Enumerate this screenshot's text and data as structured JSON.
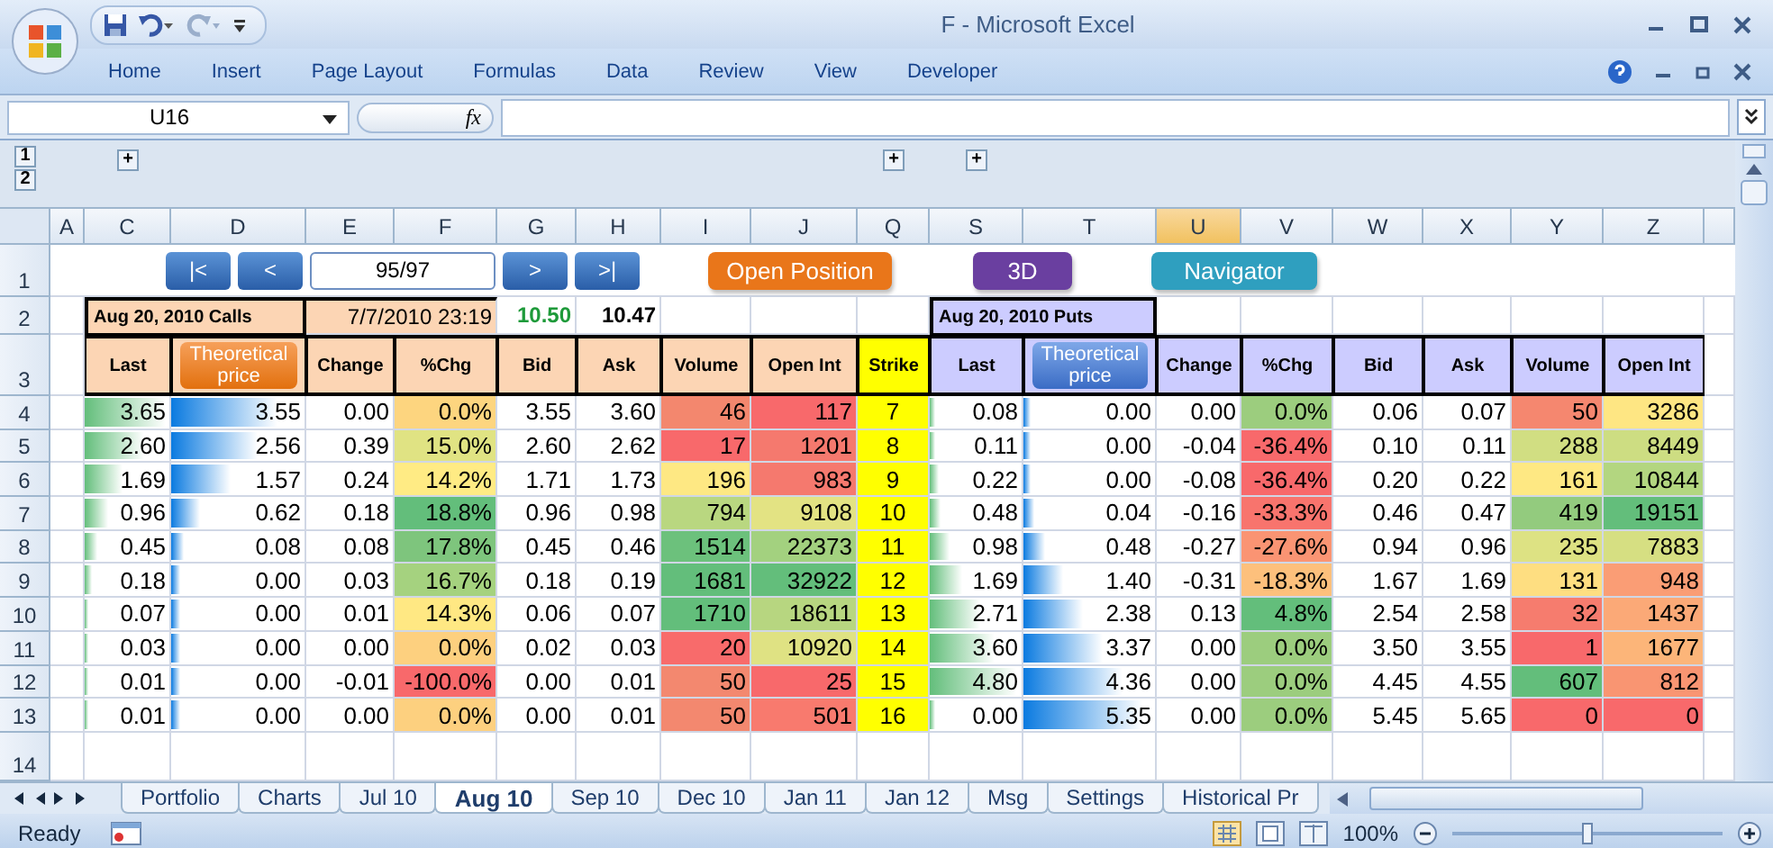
{
  "window": {
    "title": "F - Microsoft Excel"
  },
  "ribbon_tabs": [
    "Home",
    "Insert",
    "Page Layout",
    "Formulas",
    "Data",
    "Review",
    "View",
    "Developer"
  ],
  "formula_bar": {
    "name_box": "U16",
    "function_label": "fx"
  },
  "outline": {
    "levels": [
      "1",
      "2"
    ],
    "expand_buttons": [
      "+",
      "+",
      "+"
    ]
  },
  "column_headers": [
    {
      "label": "A",
      "selected": false
    },
    {
      "label": "C",
      "selected": false
    },
    {
      "label": "D",
      "selected": false
    },
    {
      "label": "E",
      "selected": false
    },
    {
      "label": "F",
      "selected": false
    },
    {
      "label": "G",
      "selected": false
    },
    {
      "label": "H",
      "selected": false
    },
    {
      "label": "I",
      "selected": false
    },
    {
      "label": "J",
      "selected": false
    },
    {
      "label": "Q",
      "selected": false
    },
    {
      "label": "S",
      "selected": false
    },
    {
      "label": "T",
      "selected": false
    },
    {
      "label": "U",
      "selected": true
    },
    {
      "label": "V",
      "selected": false
    },
    {
      "label": "W",
      "selected": false
    },
    {
      "label": "X",
      "selected": false
    },
    {
      "label": "Y",
      "selected": false
    },
    {
      "label": "Z",
      "selected": false
    }
  ],
  "row_numbers": [
    "1",
    "2",
    "3",
    "4",
    "5",
    "6",
    "7",
    "8",
    "9",
    "10",
    "11",
    "12",
    "13",
    "14"
  ],
  "navigation": {
    "back_buttons": [
      "|<",
      "<"
    ],
    "position": "95/97",
    "forward_buttons": [
      ">",
      ">|"
    ]
  },
  "action_buttons": [
    {
      "label": "Open Position",
      "color": "#e9761a"
    },
    {
      "label": "3D",
      "color": "#6a3fa0"
    },
    {
      "label": "Navigator",
      "color": "#2f9fbf"
    }
  ],
  "calls": {
    "title": "Aug 20, 2010 Calls",
    "timestamp": "7/7/2010 23:19",
    "price": "10.50",
    "price_2": "10.47"
  },
  "puts": {
    "title": "Aug 20, 2010 Puts"
  },
  "calls_columns": [
    {
      "label": "Last",
      "kind": "header"
    },
    {
      "label": "Theoretical price",
      "kind": "button"
    },
    {
      "label": "Change",
      "kind": "header"
    },
    {
      "label": "%Chg",
      "kind": "header"
    },
    {
      "label": "Bid",
      "kind": "header"
    },
    {
      "label": "Ask",
      "kind": "header"
    },
    {
      "label": "Volume",
      "kind": "header"
    },
    {
      "label": "Open Int",
      "kind": "header"
    }
  ],
  "strike_column": "Strike",
  "puts_columns": [
    {
      "label": "Last",
      "kind": "header"
    },
    {
      "label": "Theoretical price",
      "kind": "button"
    },
    {
      "label": "Change",
      "kind": "header"
    },
    {
      "label": "%Chg",
      "kind": "header"
    },
    {
      "label": "Bid",
      "kind": "header"
    },
    {
      "label": "Ask",
      "kind": "header"
    },
    {
      "label": "Volume",
      "kind": "header"
    },
    {
      "label": "Open Int",
      "kind": "header"
    }
  ],
  "rows": [
    {
      "calls": [
        {
          "text": "3.65",
          "level": 0.95
        },
        {
          "text": "3.55",
          "level": 0.8
        },
        {
          "text": "0.00"
        },
        {
          "text": "0.0%",
          "color": "#fdd57f"
        },
        {
          "text": "3.55"
        },
        {
          "text": "3.60"
        },
        {
          "text": "46",
          "color": "#f3876e"
        },
        {
          "text": "117",
          "color": "#f8696b"
        }
      ],
      "strike": "7",
      "puts": [
        {
          "text": "0.08",
          "level": 0.05
        },
        {
          "text": "0.00",
          "level": 0.06
        },
        {
          "text": "0.00"
        },
        {
          "text": "0.0%",
          "color": "#9ccd7e"
        },
        {
          "text": "0.06"
        },
        {
          "text": "0.07"
        },
        {
          "text": "50",
          "color": "#f5876f"
        },
        {
          "text": "3286",
          "color": "#fee683"
        }
      ]
    },
    {
      "calls": [
        {
          "text": "2.60",
          "level": 0.7
        },
        {
          "text": "2.56",
          "level": 0.65
        },
        {
          "text": "0.39"
        },
        {
          "text": "15.0%",
          "color": "#e0e383"
        },
        {
          "text": "2.60"
        },
        {
          "text": "2.62"
        },
        {
          "text": "17",
          "color": "#f8696b"
        },
        {
          "text": "1201",
          "color": "#f5796e"
        }
      ],
      "strike": "8",
      "puts": [
        {
          "text": "0.11",
          "level": 0.06
        },
        {
          "text": "0.00",
          "level": 0.06
        },
        {
          "text": "-0.04"
        },
        {
          "text": "-36.4%",
          "color": "#f8696b"
        },
        {
          "text": "0.10"
        },
        {
          "text": "0.11"
        },
        {
          "text": "288",
          "color": "#d1de82"
        },
        {
          "text": "8449",
          "color": "#cddd82"
        }
      ]
    },
    {
      "calls": [
        {
          "text": "1.69",
          "level": 0.45
        },
        {
          "text": "1.57",
          "level": 0.45
        },
        {
          "text": "0.24"
        },
        {
          "text": "14.2%",
          "color": "#ffeb84"
        },
        {
          "text": "1.71"
        },
        {
          "text": "1.73"
        },
        {
          "text": "196",
          "color": "#fee883"
        },
        {
          "text": "983",
          "color": "#f5796e"
        }
      ],
      "strike": "9",
      "puts": [
        {
          "text": "0.22",
          "level": 0.1
        },
        {
          "text": "0.00",
          "level": 0.06
        },
        {
          "text": "-0.08"
        },
        {
          "text": "-36.4%",
          "color": "#f8696b"
        },
        {
          "text": "0.20"
        },
        {
          "text": "0.22"
        },
        {
          "text": "161",
          "color": "#fee883"
        },
        {
          "text": "10844",
          "color": "#b3d680"
        }
      ]
    },
    {
      "calls": [
        {
          "text": "0.96",
          "level": 0.28
        },
        {
          "text": "0.62",
          "level": 0.22
        },
        {
          "text": "0.18"
        },
        {
          "text": "18.8%",
          "color": "#63be7b"
        },
        {
          "text": "0.96"
        },
        {
          "text": "0.98"
        },
        {
          "text": "794",
          "color": "#b9d780"
        },
        {
          "text": "9108",
          "color": "#e3e383"
        }
      ],
      "strike": "10",
      "puts": [
        {
          "text": "0.48",
          "level": 0.12
        },
        {
          "text": "0.04",
          "level": 0.08
        },
        {
          "text": "-0.16"
        },
        {
          "text": "-33.3%",
          "color": "#f8746d"
        },
        {
          "text": "0.46"
        },
        {
          "text": "0.47"
        },
        {
          "text": "419",
          "color": "#93cb7e"
        },
        {
          "text": "19151",
          "color": "#63be7b"
        }
      ]
    },
    {
      "calls": [
        {
          "text": "0.45",
          "level": 0.15
        },
        {
          "text": "0.08",
          "level": 0.1
        },
        {
          "text": "0.08"
        },
        {
          "text": "17.8%",
          "color": "#7ec57d"
        },
        {
          "text": "0.45"
        },
        {
          "text": "0.46"
        },
        {
          "text": "1514",
          "color": "#6cc17c"
        },
        {
          "text": "22373",
          "color": "#a3d17f"
        }
      ],
      "strike": "11",
      "puts": [
        {
          "text": "0.98",
          "level": 0.22
        },
        {
          "text": "0.48",
          "level": 0.16
        },
        {
          "text": "-0.27"
        },
        {
          "text": "-27.6%",
          "color": "#fa9473"
        },
        {
          "text": "0.94"
        },
        {
          "text": "0.96"
        },
        {
          "text": "235",
          "color": "#dde283"
        },
        {
          "text": "7883",
          "color": "#d6df82"
        }
      ]
    },
    {
      "calls": [
        {
          "text": "0.18",
          "level": 0.08
        },
        {
          "text": "0.00",
          "level": 0.07
        },
        {
          "text": "0.03"
        },
        {
          "text": "16.7%",
          "color": "#a5d27f"
        },
        {
          "text": "0.18"
        },
        {
          "text": "0.19"
        },
        {
          "text": "1681",
          "color": "#63be7b"
        },
        {
          "text": "32922",
          "color": "#63be7b"
        }
      ],
      "strike": "12",
      "puts": [
        {
          "text": "1.69",
          "level": 0.35
        },
        {
          "text": "1.40",
          "level": 0.3
        },
        {
          "text": "-0.31"
        },
        {
          "text": "-18.3%",
          "color": "#fdc07c"
        },
        {
          "text": "1.67"
        },
        {
          "text": "1.69"
        },
        {
          "text": "131",
          "color": "#fede81"
        },
        {
          "text": "948",
          "color": "#fa9d75"
        }
      ]
    },
    {
      "calls": [
        {
          "text": "0.07",
          "level": 0.05
        },
        {
          "text": "0.00",
          "level": 0.07
        },
        {
          "text": "0.01"
        },
        {
          "text": "14.3%",
          "color": "#ffe883"
        },
        {
          "text": "0.06"
        },
        {
          "text": "0.07"
        },
        {
          "text": "1710",
          "color": "#63be7b"
        },
        {
          "text": "18611",
          "color": "#b7d680"
        }
      ],
      "strike": "13",
      "puts": [
        {
          "text": "2.71",
          "level": 0.55
        },
        {
          "text": "2.38",
          "level": 0.45
        },
        {
          "text": "0.13"
        },
        {
          "text": "4.8%",
          "color": "#63be7b"
        },
        {
          "text": "2.54"
        },
        {
          "text": "2.58"
        },
        {
          "text": "32",
          "color": "#f67c6e"
        },
        {
          "text": "1437",
          "color": "#fba977"
        }
      ]
    },
    {
      "calls": [
        {
          "text": "0.03",
          "level": 0.05
        },
        {
          "text": "0.00",
          "level": 0.07
        },
        {
          "text": "0.00"
        },
        {
          "text": "0.0%",
          "color": "#fdd07f"
        },
        {
          "text": "0.02"
        },
        {
          "text": "0.03"
        },
        {
          "text": "20",
          "color": "#f86b6b"
        },
        {
          "text": "10920",
          "color": "#dfe283"
        }
      ],
      "strike": "14",
      "puts": [
        {
          "text": "3.60",
          "level": 0.7
        },
        {
          "text": "3.37",
          "level": 0.6
        },
        {
          "text": "0.00"
        },
        {
          "text": "0.0%",
          "color": "#9ccd7e"
        },
        {
          "text": "3.50"
        },
        {
          "text": "3.55"
        },
        {
          "text": "1",
          "color": "#f8696b"
        },
        {
          "text": "1677",
          "color": "#fcb579"
        }
      ]
    },
    {
      "calls": [
        {
          "text": "0.01",
          "level": 0.05
        },
        {
          "text": "0.00",
          "level": 0.07
        },
        {
          "text": "-0.01"
        },
        {
          "text": "-100.0%",
          "color": "#f8696b"
        },
        {
          "text": "0.00"
        },
        {
          "text": "0.01"
        },
        {
          "text": "50",
          "color": "#f3886f"
        },
        {
          "text": "25",
          "color": "#f8696b"
        }
      ],
      "strike": "15",
      "puts": [
        {
          "text": "4.80",
          "level": 0.95
        },
        {
          "text": "4.36",
          "level": 0.75
        },
        {
          "text": "0.00"
        },
        {
          "text": "0.0%",
          "color": "#9ccd7e"
        },
        {
          "text": "4.45"
        },
        {
          "text": "4.55"
        },
        {
          "text": "607",
          "color": "#63be7b"
        },
        {
          "text": "812",
          "color": "#f99572"
        }
      ]
    },
    {
      "calls": [
        {
          "text": "0.01",
          "level": 0.05
        },
        {
          "text": "0.00",
          "level": 0.07
        },
        {
          "text": "0.00"
        },
        {
          "text": "0.0%",
          "color": "#fdd07f"
        },
        {
          "text": "0.00"
        },
        {
          "text": "0.01"
        },
        {
          "text": "50",
          "color": "#f3886f"
        },
        {
          "text": "501",
          "color": "#f87a6e"
        }
      ],
      "strike": "16",
      "puts": [
        {
          "text": "0.00",
          "level": 0.05
        },
        {
          "text": "5.35",
          "level": 0.9
        },
        {
          "text": "0.00"
        },
        {
          "text": "0.0%",
          "color": "#9ccd7e"
        },
        {
          "text": "5.45"
        },
        {
          "text": "5.65"
        },
        {
          "text": "0",
          "color": "#f8696b"
        },
        {
          "text": "0",
          "color": "#f8696b"
        }
      ]
    }
  ],
  "sheet_tabs": [
    {
      "label": "Portfolio",
      "selected": false
    },
    {
      "label": "Charts",
      "selected": false
    },
    {
      "label": "Jul 10",
      "selected": false
    },
    {
      "label": "Aug 10",
      "selected": true
    },
    {
      "label": "Sep 10",
      "selected": false
    },
    {
      "label": "Dec 10",
      "selected": false
    },
    {
      "label": "Jan 11",
      "selected": false
    },
    {
      "label": "Jan 12",
      "selected": false
    },
    {
      "label": "Msg",
      "selected": false
    },
    {
      "label": "Settings",
      "selected": false
    },
    {
      "label": "Historical Pr",
      "selected": false
    }
  ],
  "status_bar": {
    "text": "Ready",
    "zoom": "100%",
    "zoom_slider": {
      "level": 0.5
    }
  }
}
